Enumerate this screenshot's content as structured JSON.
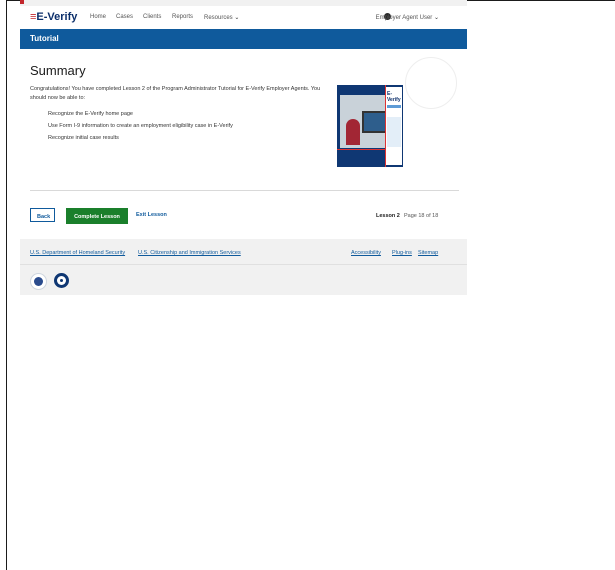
{
  "header": {
    "logo": "E-Verify",
    "nav": [
      "Home",
      "Cases",
      "Clients",
      "Reports",
      "Resources"
    ],
    "user": "Employer Agent User"
  },
  "tutorial_bar": {
    "label": "Tutorial"
  },
  "main": {
    "title": "Summary",
    "intro": "Congratulations! You have completed Lesson 2 of the Program Administrator Tutorial for E-Verify Employer Agents. You should now be able to:",
    "bullets": [
      "Recognize the E-Verify home page",
      "Use Form I-9 information to create an employment eligibility case in E-Verify",
      "Recognize initial case results"
    ],
    "thumbnail_label": "E-Verify"
  },
  "actions": {
    "back": "Back",
    "complete": "Complete Lesson",
    "exit": "Exit Lesson",
    "lesson": "Lesson 2",
    "page": "Page 18 of 18"
  },
  "footer": {
    "links_left": [
      "U.S. Department of Homeland Security",
      "U.S. Citizenship and Immigration Services"
    ],
    "links_right": [
      "Accessibility",
      "Plug-ins",
      "Sitemap"
    ]
  },
  "colors": {
    "primary": "#0f5a9c",
    "success": "#1a7f2b",
    "brand_red": "#c3272d"
  }
}
